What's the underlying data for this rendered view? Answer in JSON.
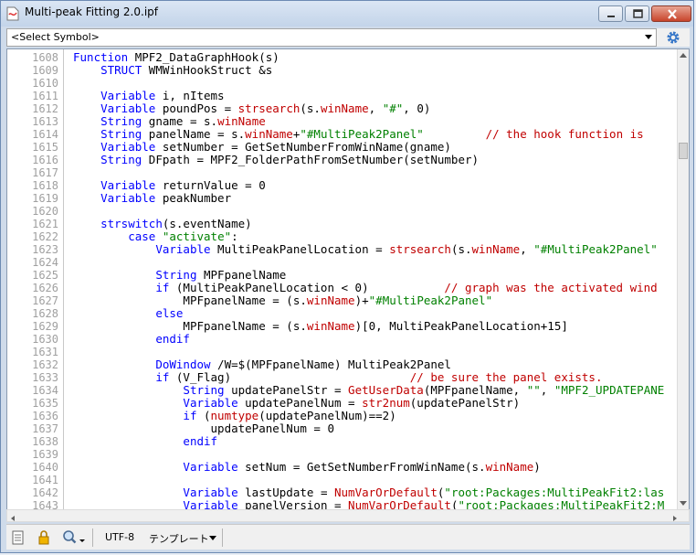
{
  "window": {
    "title": "Multi-peak Fitting 2.0.ipf"
  },
  "symbol_bar": {
    "selected": "<Select Symbol>"
  },
  "status_bar": {
    "encoding": "UTF-8",
    "template_label": "テンプレート"
  },
  "editor": {
    "lines": [
      {
        "n": "1608",
        "i": 0,
        "t": [
          [
            "k",
            "Function "
          ],
          [
            "",
            "MPF2_DataGraphHook(s)"
          ]
        ]
      },
      {
        "n": "1609",
        "i": 4,
        "t": [
          [
            "k",
            "STRUCT "
          ],
          [
            "",
            "WMWinHookStruct &s"
          ]
        ]
      },
      {
        "n": "1610",
        "i": 0,
        "t": []
      },
      {
        "n": "1611",
        "i": 4,
        "t": [
          [
            "k",
            "Variable "
          ],
          [
            "",
            "i, nItems"
          ]
        ]
      },
      {
        "n": "1612",
        "i": 4,
        "t": [
          [
            "k",
            "Variable "
          ],
          [
            "",
            "poundPos = "
          ],
          [
            "f",
            "strsearch"
          ],
          [
            "",
            "(s."
          ],
          [
            "f",
            "winName"
          ],
          [
            "",
            ", "
          ],
          [
            "s",
            "\"#\""
          ],
          [
            "",
            ", 0)"
          ]
        ]
      },
      {
        "n": "1613",
        "i": 4,
        "t": [
          [
            "k",
            "String "
          ],
          [
            "",
            "gname = s."
          ],
          [
            "f",
            "winName"
          ]
        ]
      },
      {
        "n": "1614",
        "i": 4,
        "t": [
          [
            "k",
            "String "
          ],
          [
            "",
            "panelName = s."
          ],
          [
            "f",
            "winName"
          ],
          [
            "",
            "+"
          ],
          [
            "s",
            "\"#MultiPeak2Panel\""
          ],
          [
            "",
            "         "
          ],
          [
            "c",
            "// the hook function is"
          ]
        ]
      },
      {
        "n": "1615",
        "i": 4,
        "t": [
          [
            "k",
            "Variable "
          ],
          [
            "",
            "setNumber = GetSetNumberFromWinName(gname)"
          ]
        ]
      },
      {
        "n": "1616",
        "i": 4,
        "t": [
          [
            "k",
            "String "
          ],
          [
            "",
            "DFpath = MPF2_FolderPathFromSetNumber(setNumber)"
          ]
        ]
      },
      {
        "n": "1617",
        "i": 0,
        "t": []
      },
      {
        "n": "1618",
        "i": 4,
        "t": [
          [
            "k",
            "Variable "
          ],
          [
            "",
            "returnValue = 0"
          ]
        ]
      },
      {
        "n": "1619",
        "i": 4,
        "t": [
          [
            "k",
            "Variable "
          ],
          [
            "",
            "peakNumber"
          ]
        ]
      },
      {
        "n": "1620",
        "i": 0,
        "t": []
      },
      {
        "n": "1621",
        "i": 4,
        "t": [
          [
            "k",
            "strswitch"
          ],
          [
            "",
            "(s.eventName)"
          ]
        ]
      },
      {
        "n": "1622",
        "i": 8,
        "t": [
          [
            "k",
            "case "
          ],
          [
            "s",
            "\"activate\""
          ],
          [
            "",
            ":"
          ]
        ]
      },
      {
        "n": "1623",
        "i": 12,
        "t": [
          [
            "k",
            "Variable "
          ],
          [
            "",
            "MultiPeakPanelLocation = "
          ],
          [
            "f",
            "strsearch"
          ],
          [
            "",
            "(s."
          ],
          [
            "f",
            "winName"
          ],
          [
            "",
            ", "
          ],
          [
            "s",
            "\"#MultiPeak2Panel\""
          ]
        ]
      },
      {
        "n": "1624",
        "i": 0,
        "t": []
      },
      {
        "n": "1625",
        "i": 12,
        "t": [
          [
            "k",
            "String "
          ],
          [
            "",
            "MPFpanelName"
          ]
        ]
      },
      {
        "n": "1626",
        "i": 12,
        "t": [
          [
            "k",
            "if "
          ],
          [
            "",
            "(MultiPeakPanelLocation < 0)           "
          ],
          [
            "c",
            "// graph was the activated wind"
          ]
        ]
      },
      {
        "n": "1627",
        "i": 16,
        "t": [
          [
            "",
            "MPFpanelName = (s."
          ],
          [
            "f",
            "winName"
          ],
          [
            "",
            ")+"
          ],
          [
            "s",
            "\"#MultiPeak2Panel\""
          ]
        ]
      },
      {
        "n": "1628",
        "i": 12,
        "t": [
          [
            "k",
            "else"
          ]
        ]
      },
      {
        "n": "1629",
        "i": 16,
        "t": [
          [
            "",
            "MPFpanelName = (s."
          ],
          [
            "f",
            "winName"
          ],
          [
            "",
            ")[0, MultiPeakPanelLocation+15]"
          ]
        ]
      },
      {
        "n": "1630",
        "i": 12,
        "t": [
          [
            "k",
            "endif"
          ]
        ]
      },
      {
        "n": "1631",
        "i": 0,
        "t": []
      },
      {
        "n": "1632",
        "i": 12,
        "t": [
          [
            "k",
            "DoWindow "
          ],
          [
            "",
            "/W=$(MPFpanelName) MultiPeak2Panel"
          ]
        ]
      },
      {
        "n": "1633",
        "i": 12,
        "t": [
          [
            "k",
            "if "
          ],
          [
            "",
            "(V_Flag)                          "
          ],
          [
            "c",
            "// be sure the panel exists."
          ]
        ]
      },
      {
        "n": "1634",
        "i": 16,
        "t": [
          [
            "k",
            "String "
          ],
          [
            "",
            "updatePanelStr = "
          ],
          [
            "f",
            "GetUserData"
          ],
          [
            "",
            "(MPFpanelName, "
          ],
          [
            "s",
            "\"\""
          ],
          [
            "",
            ", "
          ],
          [
            "s",
            "\"MPF2_UPDATEPANE"
          ]
        ]
      },
      {
        "n": "1635",
        "i": 16,
        "t": [
          [
            "k",
            "Variable "
          ],
          [
            "",
            "updatePanelNum = "
          ],
          [
            "f",
            "str2num"
          ],
          [
            "",
            "(updatePanelStr)"
          ]
        ]
      },
      {
        "n": "1636",
        "i": 16,
        "t": [
          [
            "k",
            "if "
          ],
          [
            "",
            "("
          ],
          [
            "f",
            "numtype"
          ],
          [
            "",
            "(updatePanelNum)==2)"
          ]
        ]
      },
      {
        "n": "1637",
        "i": 20,
        "t": [
          [
            "",
            "updatePanelNum = 0"
          ]
        ]
      },
      {
        "n": "1638",
        "i": 16,
        "t": [
          [
            "k",
            "endif"
          ]
        ]
      },
      {
        "n": "1639",
        "i": 0,
        "t": []
      },
      {
        "n": "1640",
        "i": 16,
        "t": [
          [
            "k",
            "Variable "
          ],
          [
            "",
            "setNum = GetSetNumberFromWinName(s."
          ],
          [
            "f",
            "winName"
          ],
          [
            "",
            ")"
          ]
        ]
      },
      {
        "n": "1641",
        "i": 0,
        "t": []
      },
      {
        "n": "1642",
        "i": 16,
        "t": [
          [
            "k",
            "Variable "
          ],
          [
            "",
            "lastUpdate = "
          ],
          [
            "f",
            "NumVarOrDefault"
          ],
          [
            "",
            "("
          ],
          [
            "s",
            "\"root:Packages:MultiPeakFit2:las"
          ]
        ]
      },
      {
        "n": "1643",
        "i": 16,
        "t": [
          [
            "k",
            "Variable "
          ],
          [
            "",
            "panelVersion = "
          ],
          [
            "f",
            "NumVarOrDefault"
          ],
          [
            "",
            "("
          ],
          [
            "s",
            "\"root:Packages:MultiPeakFit2:M"
          ]
        ]
      }
    ]
  }
}
